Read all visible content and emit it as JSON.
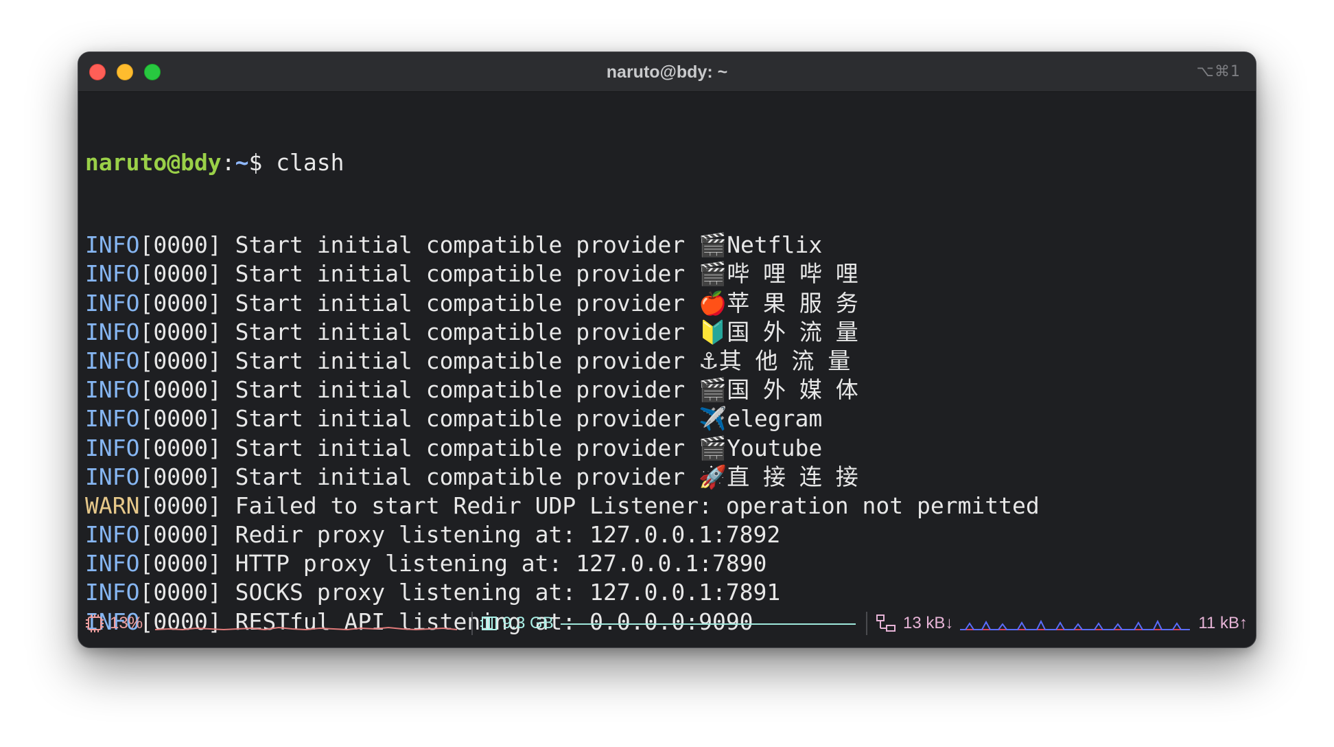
{
  "window": {
    "title": "naruto@bdy: ~",
    "shortcut": "⌥⌘1"
  },
  "terminal": {
    "prompt": {
      "user_host": "naruto@bdy",
      "sep": ":",
      "path": "~",
      "symbol": "$",
      "command": "clash"
    },
    "lines": [
      {
        "level": "INFO",
        "code": "[0000]",
        "message": "Start initial compatible provider ",
        "emoji": "🎬",
        "name": "Netflix"
      },
      {
        "level": "INFO",
        "code": "[0000]",
        "message": "Start initial compatible provider ",
        "emoji": "🎬",
        "name": "哔 哩 哔 哩"
      },
      {
        "level": "INFO",
        "code": "[0000]",
        "message": "Start initial compatible provider ",
        "emoji": "🍎",
        "name": "苹 果 服 务"
      },
      {
        "level": "INFO",
        "code": "[0000]",
        "message": "Start initial compatible provider ",
        "emoji": "🔰",
        "name": "国 外 流 量"
      },
      {
        "level": "INFO",
        "code": "[0000]",
        "message": "Start initial compatible provider ",
        "emoji": "⚓",
        "name": "其 他 流 量"
      },
      {
        "level": "INFO",
        "code": "[0000]",
        "message": "Start initial compatible provider ",
        "emoji": "🎬",
        "name": "国 外 媒 体"
      },
      {
        "level": "INFO",
        "code": "[0000]",
        "message": "Start initial compatible provider ",
        "emoji": "✈️",
        "name": "elegram"
      },
      {
        "level": "INFO",
        "code": "[0000]",
        "message": "Start initial compatible provider ",
        "emoji": "🎬",
        "name": "Youtube"
      },
      {
        "level": "INFO",
        "code": "[0000]",
        "message": "Start initial compatible provider ",
        "emoji": "🚀",
        "name": "直 接 连 接"
      },
      {
        "level": "WARN",
        "code": "[0000]",
        "message": "Failed to start Redir UDP Listener: operation not permitted",
        "emoji": "",
        "name": ""
      },
      {
        "level": "INFO",
        "code": "[0000]",
        "message": "Redir proxy listening at: 127.0.0.1:7892",
        "emoji": "",
        "name": ""
      },
      {
        "level": "INFO",
        "code": "[0000]",
        "message": "HTTP proxy listening at: 127.0.0.1:7890",
        "emoji": "",
        "name": ""
      },
      {
        "level": "INFO",
        "code": "[0000]",
        "message": "SOCKS proxy listening at: 127.0.0.1:7891",
        "emoji": "",
        "name": ""
      },
      {
        "level": "INFO",
        "code": "[0000]",
        "message": "RESTful API listening at: 0.0.0.0:9090",
        "emoji": "",
        "name": ""
      }
    ]
  },
  "statusbar": {
    "cpu": {
      "label": "13%",
      "icon": "cpu-icon",
      "color": "#f0a0a0"
    },
    "memory": {
      "label": "9.3 GB",
      "icon": "memory-icon",
      "color": "#a9f0e6"
    },
    "network": {
      "down_label": "13 kB↓",
      "up_label": "11 kB↑",
      "icon": "network-icon",
      "color": "#e7b4d7"
    }
  },
  "colors": {
    "prompt_user": "#9ad048",
    "info": "#86b6f2",
    "warn": "#e6c88a",
    "background": "#1e1f22"
  }
}
